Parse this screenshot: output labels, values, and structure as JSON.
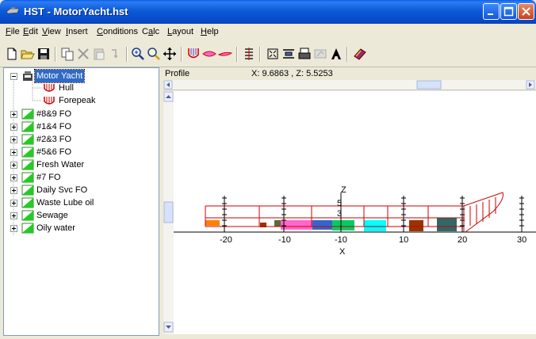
{
  "window": {
    "title": "HST - MotorYacht.hst"
  },
  "menu": {
    "items": [
      {
        "label": "File",
        "key": "F"
      },
      {
        "label": "Edit",
        "key": "E"
      },
      {
        "label": "View",
        "key": "V"
      },
      {
        "label": "Insert",
        "key": "I"
      },
      {
        "label": "Conditions",
        "key": "C"
      },
      {
        "label": "Calc",
        "key": "a"
      },
      {
        "label": "Layout",
        "key": "L"
      },
      {
        "label": "Help",
        "key": "H"
      }
    ]
  },
  "toolbar": {
    "buttons": [
      "new-file-icon",
      "open-folder-icon",
      "save-icon",
      "copy-icon",
      "delete-icon",
      "paste-icon",
      "undo-icon",
      "zoom-in-icon",
      "zoom-icon",
      "pan-icon",
      "hull-icon",
      "section-icon",
      "waterline-icon",
      "tank-icon",
      "fit-icon",
      "properties-icon",
      "print-icon",
      "report-icon",
      "text-icon",
      "book-icon"
    ]
  },
  "tree": {
    "root": "Motor Yacht",
    "children": [
      "Hull",
      "Forepeak"
    ],
    "tanks": [
      "#8&9 FO",
      "#1&4 FO",
      "#2&3 FO",
      "#5&6 FO",
      "Fresh Water",
      "#7 FO",
      "Daily Svc FO",
      "Waste Lube oil",
      "Sewage",
      "Oily water"
    ]
  },
  "view": {
    "title": "Profile",
    "coords": "X: 9.6863 , Z: 5.5253"
  },
  "chart_data": {
    "type": "profile",
    "xlabel": "X",
    "ylabel": "Z",
    "xticks": [
      "-20",
      "-10",
      "-10",
      "10",
      "20",
      "30"
    ],
    "yticks": [
      "5",
      "3"
    ],
    "colors": {
      "hull": "#cc0000",
      "tanks": [
        "#ff8000",
        "#993300",
        "#ff66cc",
        "#3366cc",
        "#00cc66",
        "#00ffff",
        "#993300",
        "#336666"
      ]
    }
  }
}
